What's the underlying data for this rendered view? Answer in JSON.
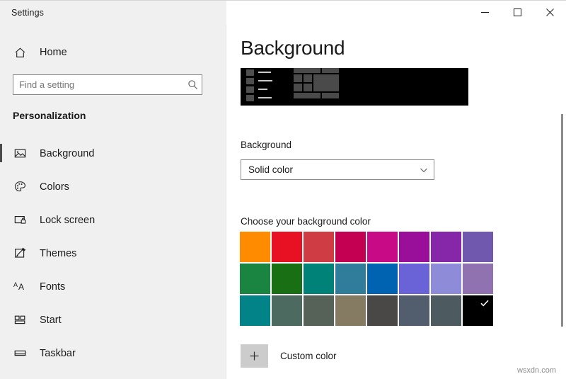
{
  "window": {
    "app_title": "Settings",
    "controls": [
      {
        "name": "minimize",
        "label": "Minimize"
      },
      {
        "name": "maximize",
        "label": "Maximize"
      },
      {
        "name": "close",
        "label": "Close"
      }
    ]
  },
  "sidebar": {
    "home_label": "Home",
    "home_icon": "home-icon",
    "search": {
      "placeholder": "Find a setting",
      "value": "",
      "icon": "search-icon"
    },
    "section_title": "Personalization",
    "items": [
      {
        "label": "Background",
        "icon": "image-icon",
        "selected": true
      },
      {
        "label": "Colors",
        "icon": "palette-icon",
        "selected": false
      },
      {
        "label": "Lock screen",
        "icon": "lock-screen-icon",
        "selected": false
      },
      {
        "label": "Themes",
        "icon": "themes-brush-icon",
        "selected": false
      },
      {
        "label": "Fonts",
        "icon": "fonts-icon",
        "selected": false
      },
      {
        "label": "Start",
        "icon": "start-tiles-icon",
        "selected": false
      },
      {
        "label": "Taskbar",
        "icon": "taskbar-icon",
        "selected": false
      }
    ]
  },
  "main": {
    "page_title": "Background",
    "preview": {
      "name": "background-preview",
      "background_color": "#000000",
      "tile_color": "#4a4a4a",
      "line_color": "#c9c9c9"
    },
    "background_section": {
      "label": "Background",
      "selected_option": "Solid color",
      "chevron_icon": "chevron-down-icon"
    },
    "color_section": {
      "label": "Choose your background color",
      "rows": [
        [
          {
            "hex": "#ff8c00",
            "selected": false
          },
          {
            "hex": "#e81123",
            "selected": false
          },
          {
            "hex": "#cf3c43",
            "selected": false
          },
          {
            "hex": "#c30052",
            "selected": false
          },
          {
            "hex": "#c90a87",
            "selected": false
          },
          {
            "hex": "#9a0f9a",
            "selected": false
          },
          {
            "hex": "#8626a8",
            "selected": false
          },
          {
            "hex": "#7058ae",
            "selected": false
          }
        ],
        [
          {
            "hex": "#1a8540",
            "selected": false
          },
          {
            "hex": "#197014",
            "selected": false
          },
          {
            "hex": "#018279",
            "selected": false
          },
          {
            "hex": "#2f7d9a",
            "selected": false
          },
          {
            "hex": "#0063b1",
            "selected": false
          },
          {
            "hex": "#6a63d8",
            "selected": false
          },
          {
            "hex": "#8e8cd8",
            "selected": false
          },
          {
            "hex": "#8f72af",
            "selected": false
          }
        ],
        [
          {
            "hex": "#028387",
            "selected": false
          },
          {
            "hex": "#4d6a60",
            "selected": false
          },
          {
            "hex": "#566258",
            "selected": false
          },
          {
            "hex": "#857b63",
            "selected": false
          },
          {
            "hex": "#4a4846",
            "selected": false
          },
          {
            "hex": "#525e6e",
            "selected": false
          },
          {
            "hex": "#4d5a60",
            "selected": false
          },
          {
            "hex": "#000000",
            "selected": true
          }
        ]
      ],
      "check_icon": "check-icon"
    },
    "custom_color": {
      "label": "Custom color",
      "plus_icon": "plus-icon",
      "swatch_color": "#cccccc"
    }
  },
  "scrollbar": {
    "name": "vertical-scrollbar"
  },
  "watermark": {
    "text": "wsxdn.com"
  }
}
